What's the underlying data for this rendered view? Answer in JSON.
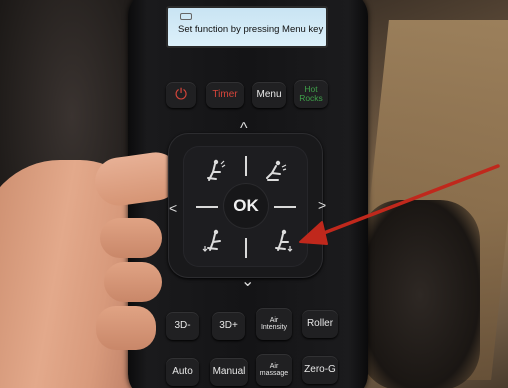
{
  "display": {
    "text": "Set function by pressing Menu key"
  },
  "buttons": {
    "power": "⏻",
    "timer": "Timer",
    "menu": "Menu",
    "hot_rocks": [
      "Hot",
      "Rocks"
    ],
    "three_d_minus": "3D-",
    "three_d_plus": "3D+",
    "air_intensity": [
      "Air",
      "Intensity"
    ],
    "roller": "Roller",
    "auto": "Auto",
    "manual": "Manual",
    "air_massage": [
      "Air",
      "massage"
    ],
    "zero_g": "Zero-G"
  },
  "dpad": {
    "ok": "OK",
    "up": "^",
    "down": "⌄",
    "left": "<",
    "right": ">"
  },
  "colors": {
    "power_red": "#d6453a",
    "timer_red": "#d6453a",
    "hot_rocks_green": "#3fa04a",
    "annotation_arrow": "#c0281c",
    "display_bg": "#d3ebf7"
  },
  "icons": [
    "recline-back-up-icon",
    "recline-back-down-icon",
    "recline-legs-up-icon",
    "recline-legs-down-icon"
  ]
}
